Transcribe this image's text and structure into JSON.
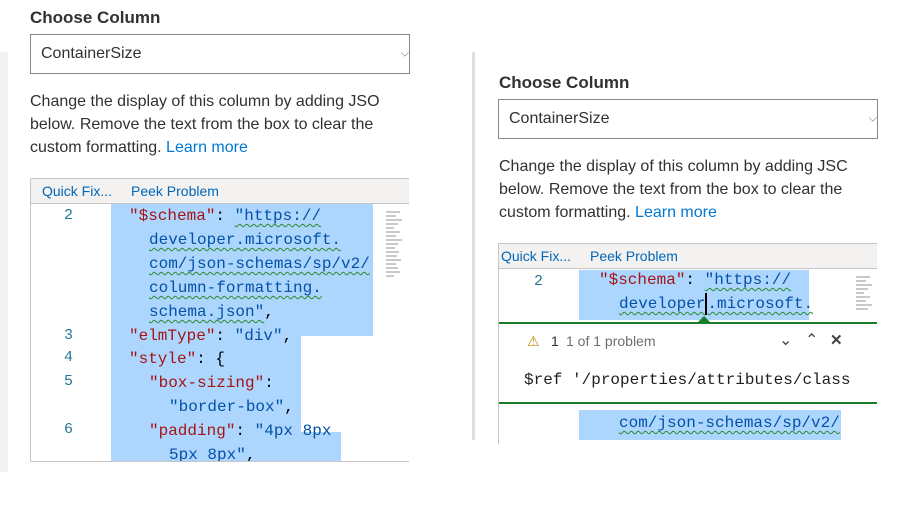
{
  "left": {
    "heading": "Choose Column",
    "dropdown_value": "ContainerSize",
    "desc_lines": [
      "Change the display of this column by adding JSO",
      "below. Remove the text from the box to clear the"
    ],
    "desc_line3_prefix": "custom formatting. ",
    "learn_more": "Learn more",
    "toolbar": {
      "quick_fix": "Quick Fix...",
      "peek_problem": "Peek Problem"
    },
    "line_numbers": [
      "2",
      "3",
      "4",
      "5",
      "6"
    ]
  },
  "right": {
    "heading": "Choose Column",
    "dropdown_value": "ContainerSize",
    "desc_lines": [
      "Change the display of this column by adding JSC",
      "below. Remove the text from the box to clear the"
    ],
    "desc_line3_prefix": "custom formatting. ",
    "learn_more": "Learn more",
    "toolbar": {
      "quick_fix": "Quick Fix...",
      "peek_problem": "Peek Problem"
    },
    "line_numbers": [
      "2"
    ],
    "problem": {
      "count": "1",
      "summary": "1 of 1 problem",
      "message": "$ref '/properties/attributes/class"
    },
    "colors": {
      "warning": "#bf8803",
      "peek_border": "#1b7f2a"
    }
  },
  "code": {
    "schema_key": "\"$schema\"",
    "colon": ": ",
    "url_1": "\"https://",
    "url_2": "developer.microsoft.",
    "url_2_right_a": "developer",
    "url_2_right_b": ".microsoft.",
    "url_3": "com/json-schemas/sp/v2/",
    "url_4": "column-formatting.",
    "url_5": "schema.json\"",
    "comma": ",",
    "elmtype_key": "\"elmType\"",
    "elmtype_val": "\"div\"",
    "style_key": "\"style\"",
    "brace": "{",
    "boxsizing_key": "\"box-sizing\"",
    "colon_only": ":",
    "boxsizing_val": "\"border-box\"",
    "padding_key": "\"padding\"",
    "padding_val_1": "\"4px 8px",
    "padding_val_2": "5px 8px\""
  }
}
